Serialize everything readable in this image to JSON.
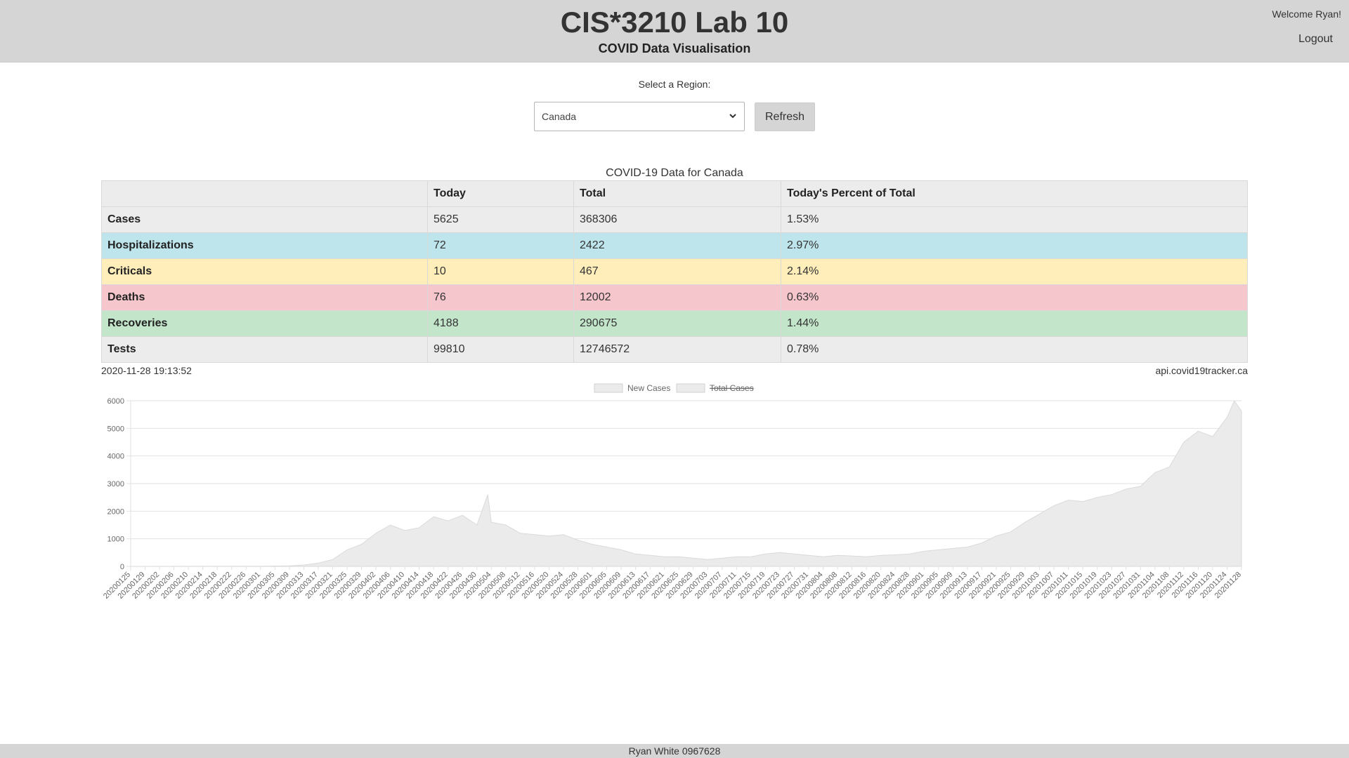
{
  "header": {
    "title": "CIS*3210 Lab 10",
    "subtitle": "COVID Data Visualisation",
    "welcome": "Welcome Ryan!",
    "logout": "Logout"
  },
  "region": {
    "label": "Select a Region:",
    "selected": "Canada",
    "refresh": "Refresh"
  },
  "table": {
    "caption": "COVID-19 Data for Canada",
    "headers": [
      "",
      "Today",
      "Total",
      "Today's Percent of Total"
    ],
    "rows": [
      {
        "label": "Cases",
        "today": "5625",
        "total": "368306",
        "percent": "1.53%"
      },
      {
        "label": "Hospitalizations",
        "today": "72",
        "total": "2422",
        "percent": "2.97%"
      },
      {
        "label": "Criticals",
        "today": "10",
        "total": "467",
        "percent": "2.14%"
      },
      {
        "label": "Deaths",
        "today": "76",
        "total": "12002",
        "percent": "0.63%"
      },
      {
        "label": "Recoveries",
        "today": "4188",
        "total": "290675",
        "percent": "1.44%"
      },
      {
        "label": "Tests",
        "today": "99810",
        "total": "12746572",
        "percent": "0.78%"
      }
    ],
    "timestamp": "2020-11-28 19:13:52",
    "source": "api.covid19tracker.ca"
  },
  "chart_data": {
    "type": "area",
    "legend": [
      {
        "name": "New Cases",
        "hidden": false
      },
      {
        "name": "Total Cases",
        "hidden": true
      }
    ],
    "ylim": [
      0,
      6000
    ],
    "yticks": [
      0,
      1000,
      2000,
      3000,
      4000,
      5000,
      6000
    ],
    "x_start": "20200125",
    "x_end": "20201128",
    "x_tick_step_days": 4,
    "x_tick_labels": [
      "20200125",
      "20200129",
      "20200202",
      "20200206",
      "20200210",
      "20200214",
      "20200218",
      "20200222",
      "20200226",
      "20200301",
      "20200305",
      "20200309",
      "20200313",
      "20200317",
      "20200321",
      "20200325",
      "20200329",
      "20200402",
      "20200406",
      "20200410",
      "20200414",
      "20200418",
      "20200422",
      "20200426",
      "20200430",
      "20200504",
      "20200508",
      "20200512",
      "20200516",
      "20200520",
      "20200524",
      "20200528",
      "20200601",
      "20200605",
      "20200609",
      "20200613",
      "20200617",
      "20200621",
      "20200625",
      "20200629",
      "20200703",
      "20200707",
      "20200711",
      "20200715",
      "20200719",
      "20200723",
      "20200727",
      "20200731",
      "20200804",
      "20200808",
      "20200812",
      "20200816",
      "20200820",
      "20200824",
      "20200828",
      "20200901",
      "20200905",
      "20200909",
      "20200913",
      "20200917",
      "20200921",
      "20200925",
      "20200929",
      "20201003",
      "20201007",
      "20201011",
      "20201015",
      "20201019",
      "20201023",
      "20201027",
      "20201031",
      "20201104",
      "20201108",
      "20201112",
      "20201116",
      "20201120",
      "20201124",
      "20201128"
    ],
    "series": [
      {
        "name": "New Cases",
        "color": "#ebebeb",
        "points": [
          [
            "20200125",
            0
          ],
          [
            "20200301",
            5
          ],
          [
            "20200309",
            20
          ],
          [
            "20200313",
            50
          ],
          [
            "20200317",
            120
          ],
          [
            "20200321",
            250
          ],
          [
            "20200325",
            600
          ],
          [
            "20200329",
            800
          ],
          [
            "20200402",
            1200
          ],
          [
            "20200406",
            1500
          ],
          [
            "20200410",
            1300
          ],
          [
            "20200414",
            1400
          ],
          [
            "20200418",
            1800
          ],
          [
            "20200422",
            1650
          ],
          [
            "20200426",
            1850
          ],
          [
            "20200430",
            1500
          ],
          [
            "20200503",
            2600
          ],
          [
            "20200504",
            1600
          ],
          [
            "20200508",
            1500
          ],
          [
            "20200512",
            1200
          ],
          [
            "20200516",
            1150
          ],
          [
            "20200520",
            1100
          ],
          [
            "20200524",
            1150
          ],
          [
            "20200528",
            950
          ],
          [
            "20200601",
            800
          ],
          [
            "20200605",
            700
          ],
          [
            "20200609",
            600
          ],
          [
            "20200613",
            450
          ],
          [
            "20200617",
            400
          ],
          [
            "20200621",
            350
          ],
          [
            "20200625",
            350
          ],
          [
            "20200629",
            300
          ],
          [
            "20200703",
            250
          ],
          [
            "20200707",
            300
          ],
          [
            "20200711",
            350
          ],
          [
            "20200715",
            350
          ],
          [
            "20200719",
            450
          ],
          [
            "20200723",
            500
          ],
          [
            "20200727",
            450
          ],
          [
            "20200731",
            400
          ],
          [
            "20200804",
            350
          ],
          [
            "20200808",
            400
          ],
          [
            "20200812",
            380
          ],
          [
            "20200816",
            350
          ],
          [
            "20200820",
            400
          ],
          [
            "20200824",
            420
          ],
          [
            "20200828",
            450
          ],
          [
            "20200901",
            550
          ],
          [
            "20200905",
            600
          ],
          [
            "20200909",
            650
          ],
          [
            "20200913",
            700
          ],
          [
            "20200917",
            850
          ],
          [
            "20200921",
            1100
          ],
          [
            "20200925",
            1250
          ],
          [
            "20200929",
            1600
          ],
          [
            "20201003",
            1900
          ],
          [
            "20201007",
            2200
          ],
          [
            "20201011",
            2400
          ],
          [
            "20201015",
            2350
          ],
          [
            "20201019",
            2500
          ],
          [
            "20201023",
            2600
          ],
          [
            "20201027",
            2800
          ],
          [
            "20201031",
            2900
          ],
          [
            "20201104",
            3400
          ],
          [
            "20201108",
            3600
          ],
          [
            "20201112",
            4500
          ],
          [
            "20201116",
            4900
          ],
          [
            "20201120",
            4700
          ],
          [
            "20201124",
            5400
          ],
          [
            "20201126",
            6000
          ],
          [
            "20201128",
            5625
          ]
        ]
      }
    ]
  },
  "footer": {
    "text": "Ryan White 0967628"
  }
}
